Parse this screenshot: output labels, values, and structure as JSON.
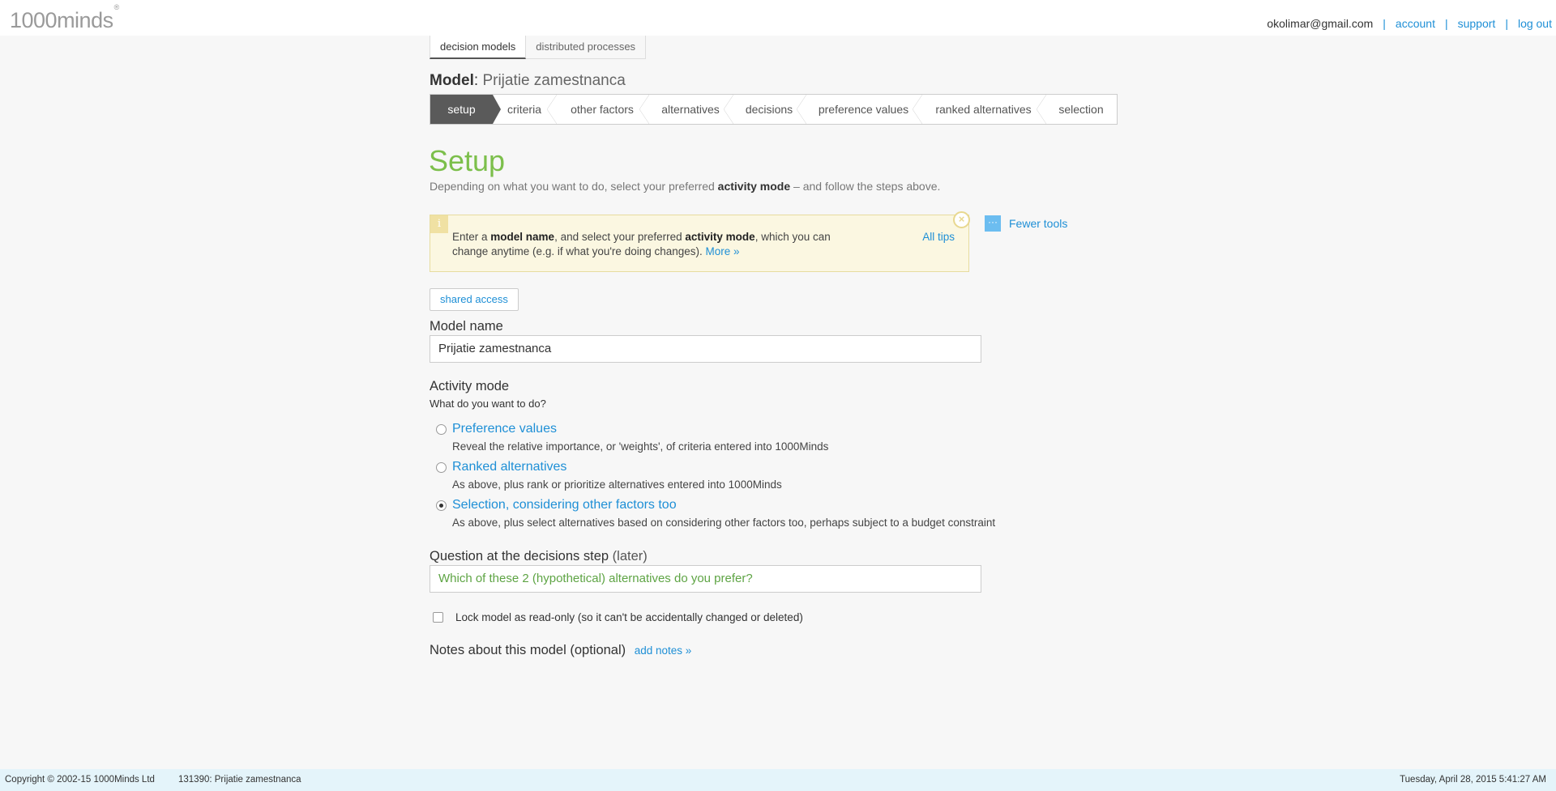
{
  "brand": {
    "logo_text": "1000minds",
    "logo_mark": "®"
  },
  "user_nav": {
    "email": "okolimar@gmail.com",
    "separator": "|",
    "account": "account",
    "support": "support",
    "logout": "log out"
  },
  "module_tabs": [
    {
      "label": "decision models",
      "active": true
    },
    {
      "label": "distributed processes",
      "active": false
    }
  ],
  "model": {
    "label": "Model",
    "colon": ":",
    "name": "Prijatie zamestnanca"
  },
  "steps": [
    {
      "label": "setup",
      "active": true
    },
    {
      "label": "criteria"
    },
    {
      "label": "other factors"
    },
    {
      "label": "alternatives"
    },
    {
      "label": "decisions"
    },
    {
      "label": "preference values"
    },
    {
      "label": "ranked alternatives"
    },
    {
      "label": "selection"
    }
  ],
  "page": {
    "heading": "Setup",
    "subtitle_pre": "Depending on what you want to do, select your preferred ",
    "subtitle_bold": "activity mode",
    "subtitle_post": " – and follow the steps above."
  },
  "tip": {
    "icon": "info-icon",
    "t1": "Enter a ",
    "b1": "model name",
    "t2": ", and select your preferred ",
    "b2": "activity mode",
    "t3": ", which you can change anytime (e.g. if what you're doing changes). ",
    "more": "More »",
    "all_tips": "All tips",
    "close": "×"
  },
  "tools": {
    "label": "Fewer tools",
    "icon_glyph": "···"
  },
  "shared_access": "shared access",
  "model_name": {
    "label": "Model name",
    "value": "Prijatie zamestnanca"
  },
  "activity": {
    "label": "Activity mode",
    "helper": "What do you want to do?",
    "options": [
      {
        "title": "Preference values",
        "desc": "Reveal the relative importance, or 'weights', of criteria entered into 1000Minds",
        "checked": false
      },
      {
        "title": "Ranked alternatives",
        "desc": "As above, plus rank or prioritize alternatives entered into 1000Minds",
        "checked": false
      },
      {
        "title": "Selection, considering other factors too",
        "desc": "As above, plus select alternatives based on considering other factors too, perhaps subject to a budget constraint",
        "checked": true
      }
    ]
  },
  "question": {
    "label": "Question at the decisions step",
    "label_suffix": "(later)",
    "value": "Which of these 2 (hypothetical) alternatives do you prefer?"
  },
  "lock": {
    "label": "Lock model as read-only (so it can't be accidentally changed or deleted)",
    "checked": false
  },
  "notes": {
    "label": "Notes about this model",
    "suffix": "(optional)",
    "link": "add notes »"
  },
  "footer": {
    "copyright": "Copyright © 2002-15 1000Minds Ltd",
    "model_ref": "131390: Prijatie zamestnanca",
    "datetime": "Tuesday, April 28, 2015 5:41:27 AM"
  },
  "colors": {
    "accent_green": "#7cbf4b",
    "link_blue": "#1e8fd6",
    "tip_bg": "#fbf7e1",
    "footer_bg": "#e4f4fa"
  }
}
